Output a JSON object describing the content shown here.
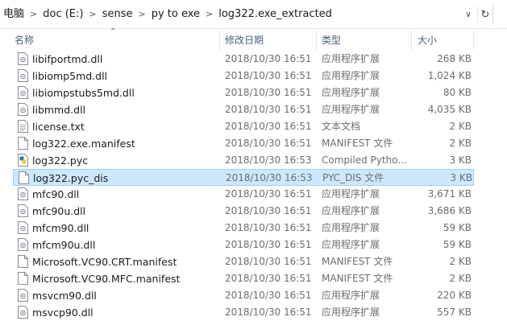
{
  "breadcrumb": [
    "电脑",
    "doc (E:)",
    "sense",
    "py to exe",
    "log322.exe_extracted"
  ],
  "columns": {
    "name": "名称",
    "modified": "修改日期",
    "type": "类型",
    "size": "大小"
  },
  "files": [
    {
      "name": "libifportmd.dll",
      "modified": "2018/10/30 16:51",
      "type": "应用程序扩展",
      "size": "268 KB",
      "icon": "dll-file-icon"
    },
    {
      "name": "libiomp5md.dll",
      "modified": "2018/10/30 16:51",
      "type": "应用程序扩展",
      "size": "1,024 KB",
      "icon": "dll-file-icon"
    },
    {
      "name": "libiompstubs5md.dll",
      "modified": "2018/10/30 16:51",
      "type": "应用程序扩展",
      "size": "80 KB",
      "icon": "dll-file-icon"
    },
    {
      "name": "libmmd.dll",
      "modified": "2018/10/30 16:51",
      "type": "应用程序扩展",
      "size": "4,035 KB",
      "icon": "dll-file-icon"
    },
    {
      "name": "license.txt",
      "modified": "2018/10/30 16:51",
      "type": "文本文档",
      "size": "2 KB",
      "icon": "text-file-icon"
    },
    {
      "name": "log322.exe.manifest",
      "modified": "2018/10/30 16:51",
      "type": "MANIFEST 文件",
      "size": "2 KB",
      "icon": "blank-file-icon"
    },
    {
      "name": "log322.pyc",
      "modified": "2018/10/30 16:53",
      "type": "Compiled Pytho...",
      "size": "3 KB",
      "icon": "python-file-icon"
    },
    {
      "name": "log322.pyc_dis",
      "modified": "2018/10/30 16:53",
      "type": "PYC_DIS 文件",
      "size": "3 KB",
      "icon": "blank-file-icon",
      "selected": true
    },
    {
      "name": "mfc90.dll",
      "modified": "2018/10/30 16:51",
      "type": "应用程序扩展",
      "size": "3,671 KB",
      "icon": "dll-file-icon"
    },
    {
      "name": "mfc90u.dll",
      "modified": "2018/10/30 16:51",
      "type": "应用程序扩展",
      "size": "3,686 KB",
      "icon": "dll-file-icon"
    },
    {
      "name": "mfcm90.dll",
      "modified": "2018/10/30 16:51",
      "type": "应用程序扩展",
      "size": "59 KB",
      "icon": "dll-file-icon"
    },
    {
      "name": "mfcm90u.dll",
      "modified": "2018/10/30 16:51",
      "type": "应用程序扩展",
      "size": "59 KB",
      "icon": "dll-file-icon"
    },
    {
      "name": "Microsoft.VC90.CRT.manifest",
      "modified": "2018/10/30 16:51",
      "type": "MANIFEST 文件",
      "size": "2 KB",
      "icon": "blank-file-icon"
    },
    {
      "name": "Microsoft.VC90.MFC.manifest",
      "modified": "2018/10/30 16:51",
      "type": "MANIFEST 文件",
      "size": "2 KB",
      "icon": "blank-file-icon"
    },
    {
      "name": "msvcm90.dll",
      "modified": "2018/10/30 16:51",
      "type": "应用程序扩展",
      "size": "220 KB",
      "icon": "dll-file-icon"
    },
    {
      "name": "msvcp90.dll",
      "modified": "2018/10/30 16:51",
      "type": "应用程序扩展",
      "size": "557 KB",
      "icon": "dll-file-icon"
    }
  ],
  "colors": {
    "selection_bg": "#cce8ff",
    "selection_border": "#99d1ff",
    "header_text": "#4c607a"
  }
}
